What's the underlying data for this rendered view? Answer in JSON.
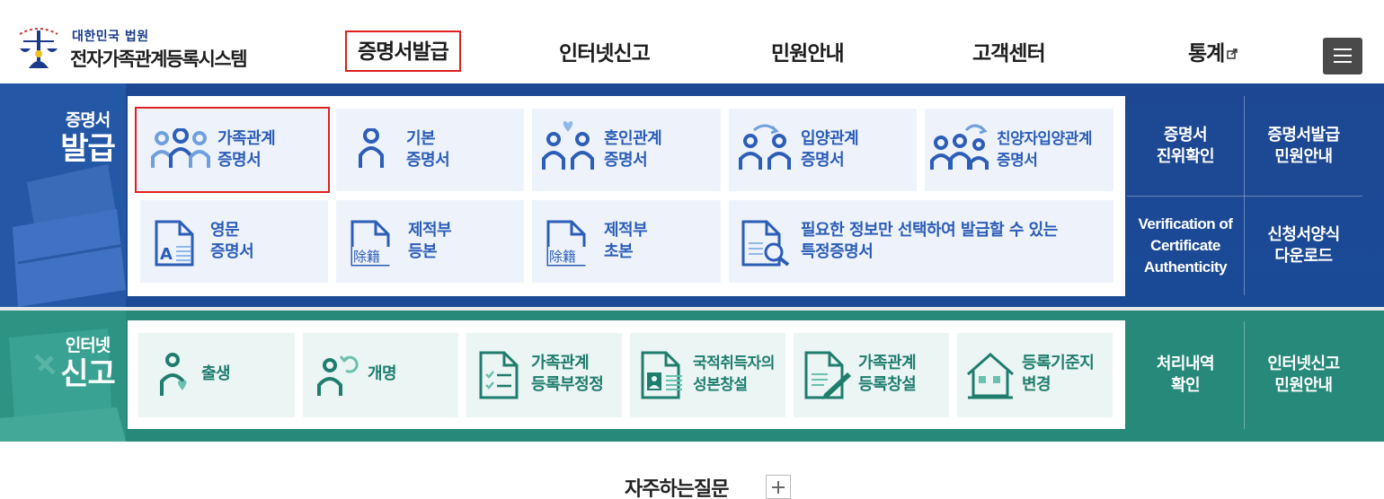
{
  "header": {
    "org_small": "대한민국 법원",
    "system_name": "전자가족관계등록시스템",
    "nav": [
      "증명서발급",
      "인터넷신고",
      "민원안내",
      "고객센터",
      "통계"
    ]
  },
  "certificate": {
    "title_small": "증명서",
    "title_big": "발급",
    "tiles": [
      {
        "line1": "가족관계",
        "line2": "증명서",
        "icon": "family-three-icon"
      },
      {
        "line1": "기본",
        "line2": "증명서",
        "icon": "person-icon"
      },
      {
        "line1": "혼인관계",
        "line2": "증명서",
        "icon": "couple-heart-icon"
      },
      {
        "line1": "입양관계",
        "line2": "증명서",
        "icon": "adoption-icon"
      },
      {
        "line1": "친양자입양관계",
        "line2": "증명서",
        "icon": "full-adoption-icon"
      },
      {
        "line1": "영문",
        "line2": "증명서",
        "icon": "english-doc-icon"
      },
      {
        "line1": "제적부",
        "line2": "등본",
        "icon": "removed-register-icon"
      },
      {
        "line1": "제적부",
        "line2": "초본",
        "icon": "removed-register-abstract-icon"
      },
      {
        "line1": "필요한 정보만 선택하여 발급할 수 있는",
        "line2": "특정증명서",
        "icon": "search-doc-icon"
      }
    ],
    "side": [
      {
        "line1": "증명서",
        "line2": "진위확인",
        "line3": ""
      },
      {
        "line1": "증명서발급",
        "line2": "민원안내",
        "line3": ""
      },
      {
        "line1": "Verification of",
        "line2": "Certificate",
        "line3": "Authenticity"
      },
      {
        "line1": "신청서양식",
        "line2": "다운로드",
        "line3": ""
      }
    ],
    "tile_glyphs": [
      "除籍",
      "除籍"
    ],
    "english_glyph": "A"
  },
  "report": {
    "title_small": "인터넷",
    "title_big": "신고",
    "tiles": [
      {
        "line1": "출생",
        "line2": "",
        "icon": "birth-icon"
      },
      {
        "line1": "개명",
        "line2": "",
        "icon": "name-change-icon"
      },
      {
        "line1": "가족관계",
        "line2": "등록부정정",
        "icon": "checklist-doc-icon"
      },
      {
        "line1": "국적취득자의",
        "line2": "성본창설",
        "icon": "nationality-doc-icon"
      },
      {
        "line1": "가족관계",
        "line2": "등록창설",
        "icon": "register-create-icon"
      },
      {
        "line1": "등록기준지",
        "line2": "변경",
        "icon": "house-icon"
      }
    ],
    "side": [
      {
        "line1": "처리내역",
        "line2": "확인"
      },
      {
        "line1": "인터넷신고",
        "line2": "민원안내"
      }
    ]
  },
  "faq": {
    "label": "자주하는질문"
  },
  "colors": {
    "blue_band": "#1d4793",
    "green_band": "#26897a",
    "tile_blue": "#2c5db7",
    "tile_green": "#1f7d6d",
    "highlight": "#e02020"
  }
}
